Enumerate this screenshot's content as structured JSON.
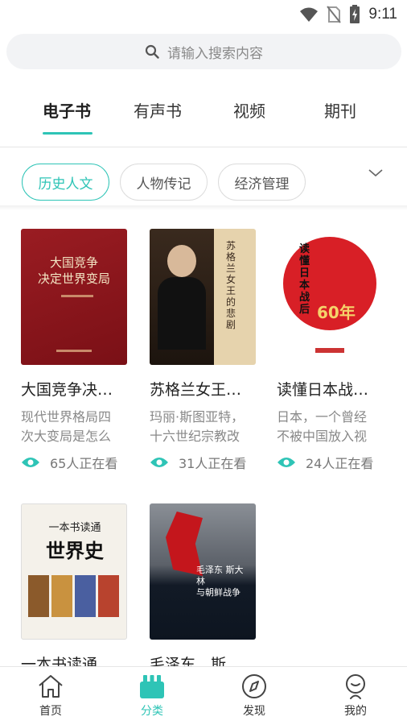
{
  "status_bar": {
    "time": "9:11",
    "icons": [
      "wifi-icon",
      "no-sim-icon",
      "battery-charging-icon"
    ]
  },
  "search": {
    "placeholder": "请输入搜索内容",
    "icon": "search-icon"
  },
  "main_tabs": [
    {
      "label": "电子书",
      "active": true
    },
    {
      "label": "有声书",
      "active": false
    },
    {
      "label": "视频",
      "active": false
    },
    {
      "label": "期刊",
      "active": false
    }
  ],
  "categories": [
    {
      "label": "历史人文",
      "active": true
    },
    {
      "label": "人物传记",
      "active": false
    },
    {
      "label": "经济管理",
      "active": false
    }
  ],
  "books": [
    {
      "title": "大国竞争决…",
      "desc": "现代世界格局四次大变局是怎么演变的？什么…",
      "views": "65人正在看",
      "cover_text": "大国竞争\n决定世界变局"
    },
    {
      "title": "苏格兰女王…",
      "desc": "玛丽·斯图亚特，十六世纪宗教改革时期苏格兰…",
      "views": "31人正在看",
      "cover_text": "苏格兰女王的悲剧"
    },
    {
      "title": "读懂日本战…",
      "desc": "日本，一个曾经不被中国放入视野的国度，一…",
      "views": "24人正在看",
      "cover_text": "读懂日本战后60年"
    },
    {
      "title": "一本书读通…",
      "desc": "",
      "views": "",
      "cover_text": "一本书读通世界史"
    },
    {
      "title": "毛泽东、斯…",
      "desc": "",
      "views": "",
      "cover_text": "毛泽东、斯大林与朝鲜战争"
    }
  ],
  "bottom_nav": [
    {
      "label": "首页",
      "icon": "home-icon",
      "active": false
    },
    {
      "label": "分类",
      "icon": "category-icon",
      "active": true
    },
    {
      "label": "发现",
      "icon": "compass-icon",
      "active": false
    },
    {
      "label": "我的",
      "icon": "profile-icon",
      "active": false
    }
  ],
  "colors": {
    "accent": "#2ec4b6",
    "text": "#222222",
    "muted": "#888888"
  }
}
